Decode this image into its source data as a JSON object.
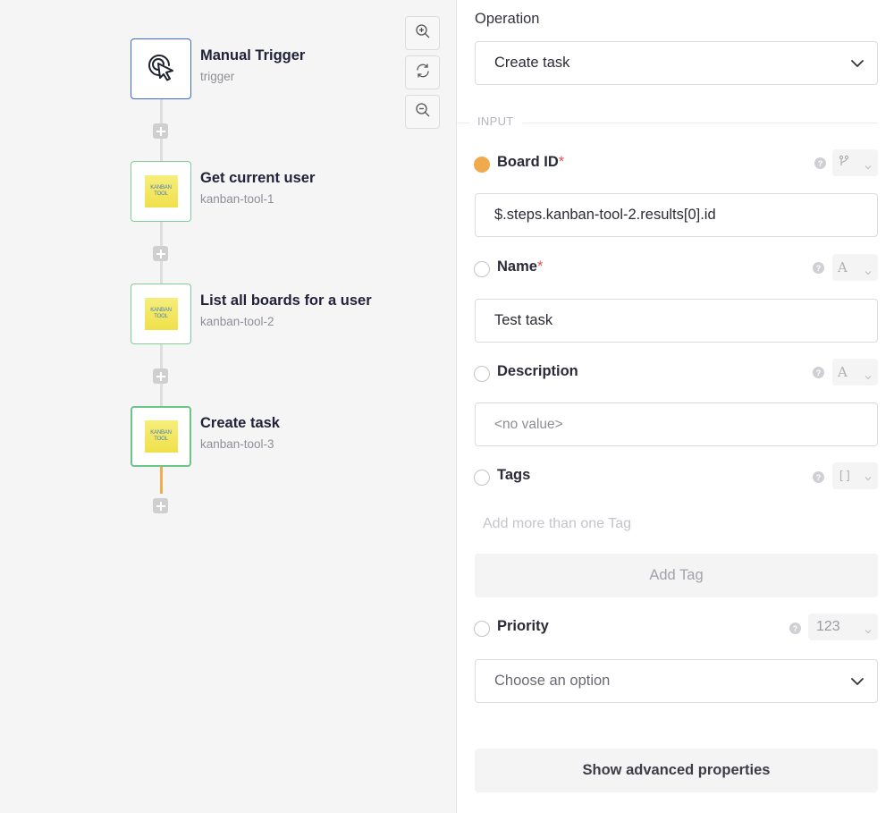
{
  "workflow": {
    "nodes": [
      {
        "title": "Manual Trigger",
        "subtitle": "trigger",
        "icon": "cursor-click-icon"
      },
      {
        "title": "Get current user",
        "subtitle": "kanban-tool-1",
        "icon": "kanban-tool-logo"
      },
      {
        "title": "List all boards for a user",
        "subtitle": "kanban-tool-2",
        "icon": "kanban-tool-logo"
      },
      {
        "title": "Create task",
        "subtitle": "kanban-tool-3",
        "icon": "kanban-tool-logo"
      }
    ],
    "logo_text": {
      "line1": "KANBAN",
      "line2": "TOOL"
    },
    "zoom_controls": [
      "zoom-in-icon",
      "refresh-icon",
      "zoom-out-icon"
    ]
  },
  "panel": {
    "operation_label": "Operation",
    "operation_value": "Create task",
    "section_label": "INPUT",
    "fields": {
      "board_id": {
        "label": "Board ID",
        "required": "*",
        "value": "$.steps.kanban-tool-2.results[0].id",
        "type_icon": "branch-icon"
      },
      "name": {
        "label": "Name",
        "required": "*",
        "value": "Test task",
        "type_icon": "A"
      },
      "description": {
        "label": "Description",
        "value": "<no value>",
        "type_icon": "A"
      },
      "tags": {
        "label": "Tags",
        "hint": "Add more than one Tag",
        "add_button": "Add Tag",
        "type_icon": "[]"
      },
      "priority": {
        "label": "Priority",
        "placeholder": "Choose an option",
        "type_icon": "123"
      }
    },
    "advanced_button": "Show advanced properties"
  },
  "colors": {
    "trigger_border": "#3d6ad6",
    "node_border": "#7fcf95",
    "active_connector": "#f2ac4e",
    "required": "#e05252"
  }
}
